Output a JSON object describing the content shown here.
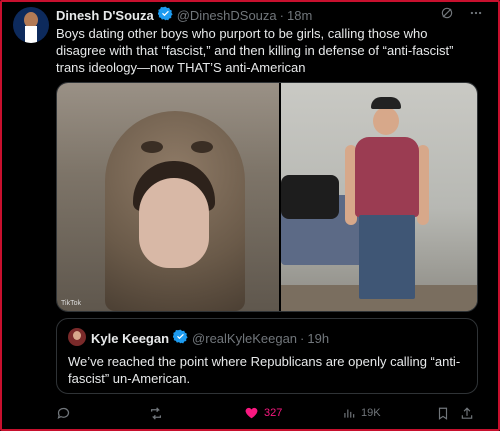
{
  "tweet": {
    "author_name": "Dinesh D'Souza",
    "handle": "@DineshDSouza",
    "separator": "·",
    "time": "18m",
    "text": "Boys dating other boys who purport to be girls, calling those who disagree with that “fascist,” and then killing in defense of “anti-fascist” trans ideology—now THAT’S anti-American",
    "media_watermark": "TikTok"
  },
  "quote": {
    "author_name": "Kyle Keegan",
    "handle": "@realKyleKeegan",
    "separator": "·",
    "time": "19h",
    "text": "We’ve reached the point where Republicans are openly calling “anti-fascist” un-American."
  },
  "actions": {
    "likes": "327",
    "views": "19K"
  },
  "colors": {
    "frame_border": "#c8102e",
    "verified": "#1d9bf0",
    "like": "#f91880",
    "muted": "#71767b"
  }
}
